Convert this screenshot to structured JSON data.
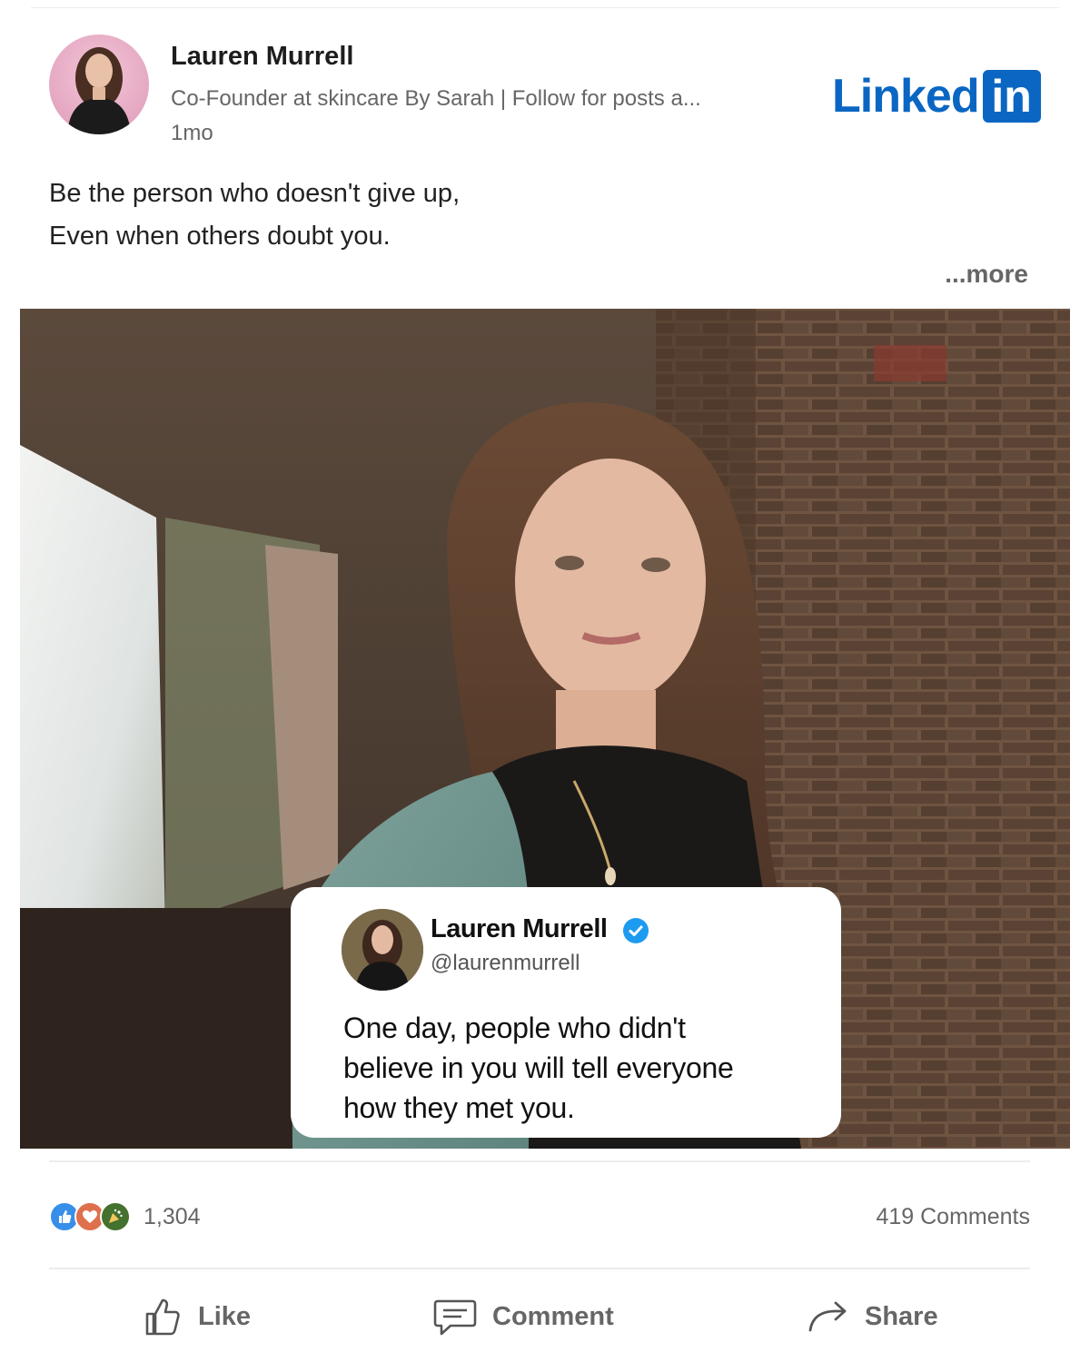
{
  "author": {
    "name": "Lauren Murrell",
    "headline": "Co-Founder at skincare By Sarah | Follow for posts a...",
    "time": "1mo"
  },
  "brand": {
    "word": "Linked",
    "box": "in",
    "color": "#0a66c2"
  },
  "post": {
    "lines": [
      "Be the person who doesn't give up,",
      "Even when others doubt you."
    ],
    "see_more": "...more"
  },
  "quote_card": {
    "name": "Lauren Murrell",
    "handle": "@laurenmurrell",
    "lines": [
      "One day, people who didn't",
      "believe in you will tell everyone",
      "how they met you."
    ]
  },
  "social": {
    "reactions": [
      "like-reaction",
      "love-reaction",
      "celebrate-reaction"
    ],
    "reaction_count": "1,304",
    "comments": "419 Comments"
  },
  "actions": {
    "like": "Like",
    "comment": "Comment",
    "share": "Share"
  }
}
